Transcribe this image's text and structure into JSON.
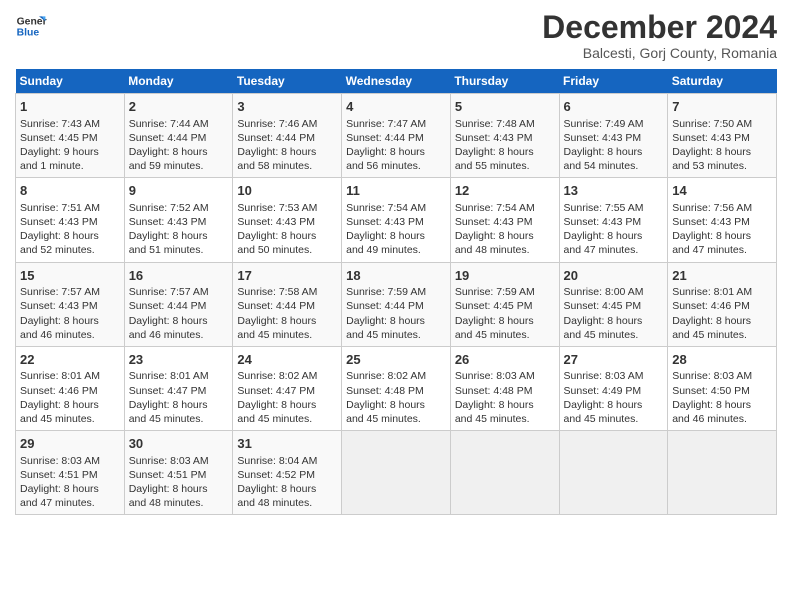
{
  "header": {
    "logo_line1": "General",
    "logo_line2": "Blue",
    "title": "December 2024",
    "subtitle": "Balcesti, Gorj County, Romania"
  },
  "days_of_week": [
    "Sunday",
    "Monday",
    "Tuesday",
    "Wednesday",
    "Thursday",
    "Friday",
    "Saturday"
  ],
  "weeks": [
    [
      {
        "day": "1",
        "lines": [
          "Sunrise: 7:43 AM",
          "Sunset: 4:45 PM",
          "Daylight: 9 hours",
          "and 1 minute."
        ]
      },
      {
        "day": "2",
        "lines": [
          "Sunrise: 7:44 AM",
          "Sunset: 4:44 PM",
          "Daylight: 8 hours",
          "and 59 minutes."
        ]
      },
      {
        "day": "3",
        "lines": [
          "Sunrise: 7:46 AM",
          "Sunset: 4:44 PM",
          "Daylight: 8 hours",
          "and 58 minutes."
        ]
      },
      {
        "day": "4",
        "lines": [
          "Sunrise: 7:47 AM",
          "Sunset: 4:44 PM",
          "Daylight: 8 hours",
          "and 56 minutes."
        ]
      },
      {
        "day": "5",
        "lines": [
          "Sunrise: 7:48 AM",
          "Sunset: 4:43 PM",
          "Daylight: 8 hours",
          "and 55 minutes."
        ]
      },
      {
        "day": "6",
        "lines": [
          "Sunrise: 7:49 AM",
          "Sunset: 4:43 PM",
          "Daylight: 8 hours",
          "and 54 minutes."
        ]
      },
      {
        "day": "7",
        "lines": [
          "Sunrise: 7:50 AM",
          "Sunset: 4:43 PM",
          "Daylight: 8 hours",
          "and 53 minutes."
        ]
      }
    ],
    [
      {
        "day": "8",
        "lines": [
          "Sunrise: 7:51 AM",
          "Sunset: 4:43 PM",
          "Daylight: 8 hours",
          "and 52 minutes."
        ]
      },
      {
        "day": "9",
        "lines": [
          "Sunrise: 7:52 AM",
          "Sunset: 4:43 PM",
          "Daylight: 8 hours",
          "and 51 minutes."
        ]
      },
      {
        "day": "10",
        "lines": [
          "Sunrise: 7:53 AM",
          "Sunset: 4:43 PM",
          "Daylight: 8 hours",
          "and 50 minutes."
        ]
      },
      {
        "day": "11",
        "lines": [
          "Sunrise: 7:54 AM",
          "Sunset: 4:43 PM",
          "Daylight: 8 hours",
          "and 49 minutes."
        ]
      },
      {
        "day": "12",
        "lines": [
          "Sunrise: 7:54 AM",
          "Sunset: 4:43 PM",
          "Daylight: 8 hours",
          "and 48 minutes."
        ]
      },
      {
        "day": "13",
        "lines": [
          "Sunrise: 7:55 AM",
          "Sunset: 4:43 PM",
          "Daylight: 8 hours",
          "and 47 minutes."
        ]
      },
      {
        "day": "14",
        "lines": [
          "Sunrise: 7:56 AM",
          "Sunset: 4:43 PM",
          "Daylight: 8 hours",
          "and 47 minutes."
        ]
      }
    ],
    [
      {
        "day": "15",
        "lines": [
          "Sunrise: 7:57 AM",
          "Sunset: 4:43 PM",
          "Daylight: 8 hours",
          "and 46 minutes."
        ]
      },
      {
        "day": "16",
        "lines": [
          "Sunrise: 7:57 AM",
          "Sunset: 4:44 PM",
          "Daylight: 8 hours",
          "and 46 minutes."
        ]
      },
      {
        "day": "17",
        "lines": [
          "Sunrise: 7:58 AM",
          "Sunset: 4:44 PM",
          "Daylight: 8 hours",
          "and 45 minutes."
        ]
      },
      {
        "day": "18",
        "lines": [
          "Sunrise: 7:59 AM",
          "Sunset: 4:44 PM",
          "Daylight: 8 hours",
          "and 45 minutes."
        ]
      },
      {
        "day": "19",
        "lines": [
          "Sunrise: 7:59 AM",
          "Sunset: 4:45 PM",
          "Daylight: 8 hours",
          "and 45 minutes."
        ]
      },
      {
        "day": "20",
        "lines": [
          "Sunrise: 8:00 AM",
          "Sunset: 4:45 PM",
          "Daylight: 8 hours",
          "and 45 minutes."
        ]
      },
      {
        "day": "21",
        "lines": [
          "Sunrise: 8:01 AM",
          "Sunset: 4:46 PM",
          "Daylight: 8 hours",
          "and 45 minutes."
        ]
      }
    ],
    [
      {
        "day": "22",
        "lines": [
          "Sunrise: 8:01 AM",
          "Sunset: 4:46 PM",
          "Daylight: 8 hours",
          "and 45 minutes."
        ]
      },
      {
        "day": "23",
        "lines": [
          "Sunrise: 8:01 AM",
          "Sunset: 4:47 PM",
          "Daylight: 8 hours",
          "and 45 minutes."
        ]
      },
      {
        "day": "24",
        "lines": [
          "Sunrise: 8:02 AM",
          "Sunset: 4:47 PM",
          "Daylight: 8 hours",
          "and 45 minutes."
        ]
      },
      {
        "day": "25",
        "lines": [
          "Sunrise: 8:02 AM",
          "Sunset: 4:48 PM",
          "Daylight: 8 hours",
          "and 45 minutes."
        ]
      },
      {
        "day": "26",
        "lines": [
          "Sunrise: 8:03 AM",
          "Sunset: 4:48 PM",
          "Daylight: 8 hours",
          "and 45 minutes."
        ]
      },
      {
        "day": "27",
        "lines": [
          "Sunrise: 8:03 AM",
          "Sunset: 4:49 PM",
          "Daylight: 8 hours",
          "and 45 minutes."
        ]
      },
      {
        "day": "28",
        "lines": [
          "Sunrise: 8:03 AM",
          "Sunset: 4:50 PM",
          "Daylight: 8 hours",
          "and 46 minutes."
        ]
      }
    ],
    [
      {
        "day": "29",
        "lines": [
          "Sunrise: 8:03 AM",
          "Sunset: 4:51 PM",
          "Daylight: 8 hours",
          "and 47 minutes."
        ]
      },
      {
        "day": "30",
        "lines": [
          "Sunrise: 8:03 AM",
          "Sunset: 4:51 PM",
          "Daylight: 8 hours",
          "and 48 minutes."
        ]
      },
      {
        "day": "31",
        "lines": [
          "Sunrise: 8:04 AM",
          "Sunset: 4:52 PM",
          "Daylight: 8 hours",
          "and 48 minutes."
        ]
      },
      {
        "day": "",
        "lines": []
      },
      {
        "day": "",
        "lines": []
      },
      {
        "day": "",
        "lines": []
      },
      {
        "day": "",
        "lines": []
      }
    ]
  ]
}
